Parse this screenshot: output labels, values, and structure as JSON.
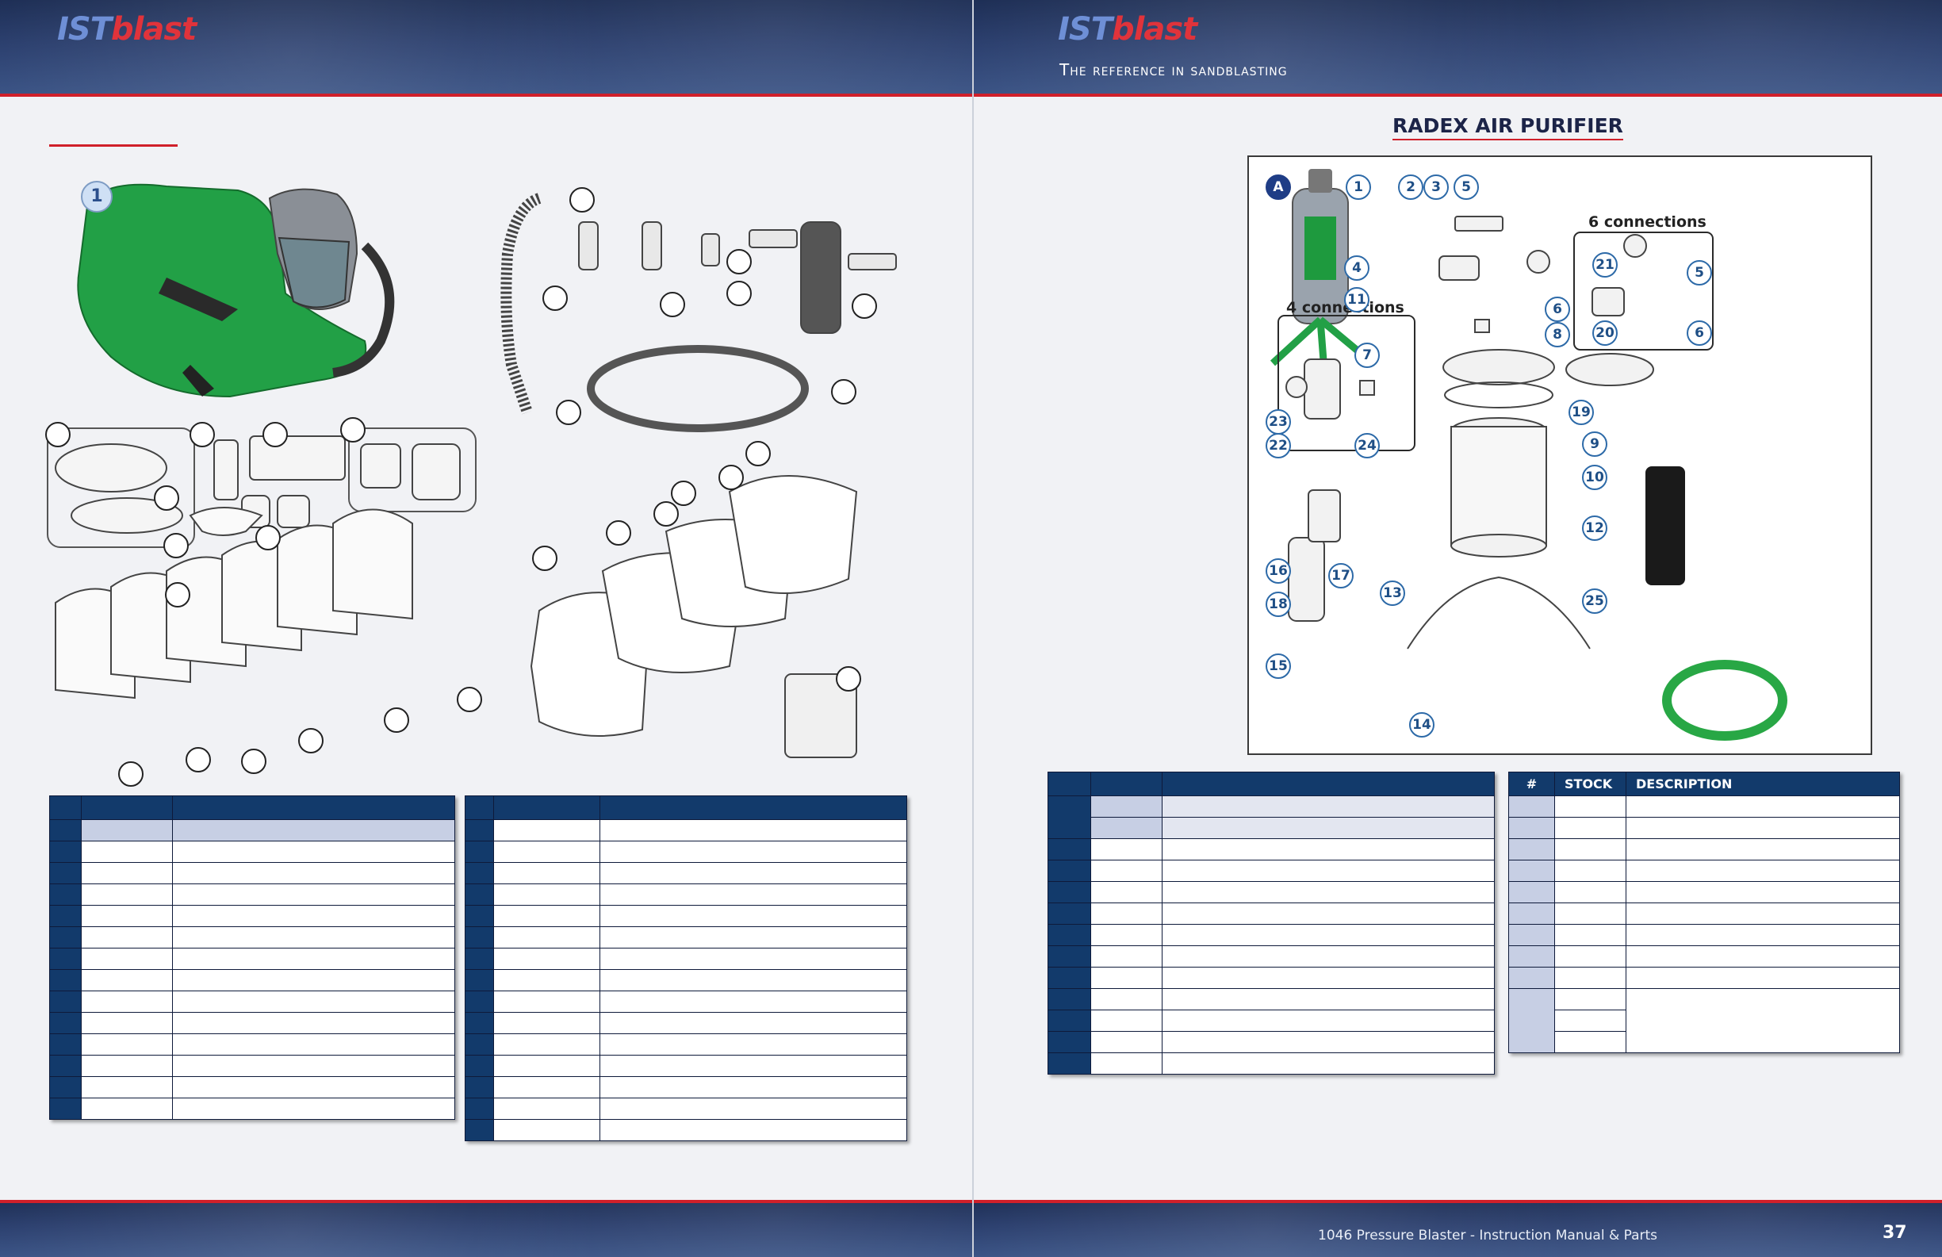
{
  "header": {
    "logo_ist": "IST",
    "logo_blast": "blast",
    "tagline": "The reference in sandblasting"
  },
  "right_page": {
    "section_title": "RADEX AIR PURIFIER",
    "connections_6": "6 connections",
    "connections_4": "4 connections",
    "table_headers": {
      "num": "#",
      "stock": "STOCK",
      "description": "DESCRIPTION"
    }
  },
  "left_page": {
    "hood_callout": "1"
  },
  "callouts": {
    "a": "A",
    "c1": "1",
    "c2": "2",
    "c3": "3",
    "c4": "4",
    "c5": "5",
    "c5b": "5",
    "c6": "6",
    "c6b": "6",
    "c7": "7",
    "c8": "8",
    "c9": "9",
    "c10": "10",
    "c11": "11",
    "c12": "12",
    "c13": "13",
    "c14": "14",
    "c15": "15",
    "c16": "16",
    "c17": "17",
    "c18": "18",
    "c19": "19",
    "c20": "20",
    "c21": "21",
    "c22": "22",
    "c23": "23",
    "c24": "24",
    "c25": "25"
  },
  "footer": {
    "manual_title": "1046 Pressure Blaster - Instruction Manual & Parts",
    "page_number": "37"
  },
  "colors": {
    "navy": "#123a6b",
    "accent_red": "#d0202a",
    "callout_blue": "#2d6aa8",
    "hood_green": "#1e9a3e"
  }
}
